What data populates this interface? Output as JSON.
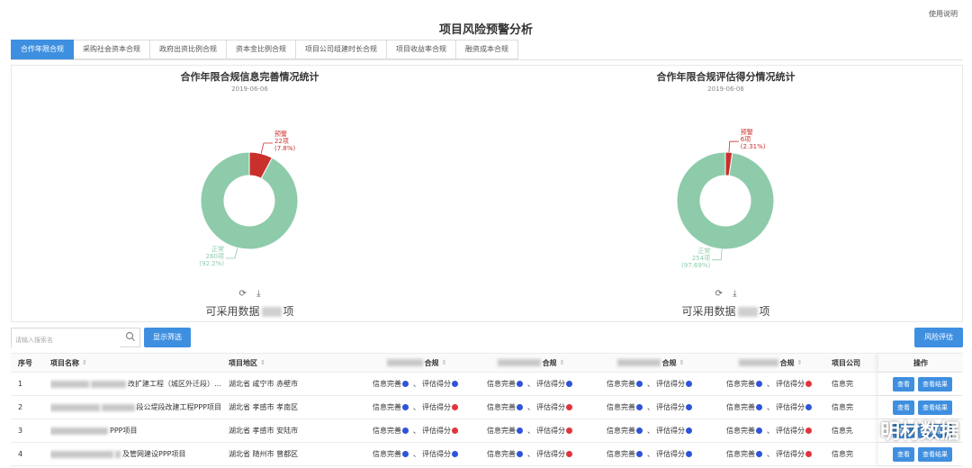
{
  "header": {
    "title": "项目风险预警分析",
    "help_link": "使用说明"
  },
  "tabs": [
    {
      "label": "合作年限合规",
      "active": true
    },
    {
      "label": "采购社会资本合规",
      "active": false
    },
    {
      "label": "政府出资比例合规",
      "active": false
    },
    {
      "label": "资本金比例合规",
      "active": false
    },
    {
      "label": "项目公司组建时长合规",
      "active": false
    },
    {
      "label": "项目收益率合规",
      "active": false
    },
    {
      "label": "融资成本合规",
      "active": false
    }
  ],
  "charts": [
    {
      "title": "合作年限合规信息完善情况统计",
      "date": "2019-06-06",
      "available_prefix": "可采用数据",
      "available_suffix": "项",
      "chart_data": {
        "type": "pie",
        "slices": [
          {
            "name": "预警",
            "count_label": "22项",
            "percent_label": "(7.8%)",
            "value": 7.8,
            "color": "#c9302c"
          },
          {
            "name": "正常",
            "count_label": "260项",
            "percent_label": "(92.2%)",
            "value": 92.2,
            "color": "#8ecbab"
          }
        ]
      }
    },
    {
      "title": "合作年限合规评估得分情况统计",
      "date": "2019-06-06",
      "available_prefix": "可采用数据",
      "available_suffix": "项",
      "chart_data": {
        "type": "pie",
        "slices": [
          {
            "name": "预警",
            "count_label": "6项",
            "percent_label": "(2.31%)",
            "value": 2.31,
            "color": "#c9302c"
          },
          {
            "name": "正常",
            "count_label": "254项",
            "percent_label": "(97.69%)",
            "value": 97.69,
            "color": "#8ecbab"
          }
        ]
      }
    }
  ],
  "toolbar": {
    "search_placeholder": "请输入搜索名",
    "filter_button": "显示筛选",
    "risk_button": "风险评估"
  },
  "table": {
    "columns": {
      "index": "序号",
      "name": "项目名称",
      "area": "项目地区",
      "k1": "合规",
      "k2": "合规",
      "k3": "合规",
      "k4": "合规",
      "k5": "项目公司",
      "op": "操作"
    },
    "status_labels": {
      "info": "信息完善",
      "score": "评估得分"
    },
    "sep": "、",
    "view_button": "查看",
    "result_button": "查看结果",
    "rows": [
      {
        "index": "1",
        "name_suffix": "改扩建工程（城区外迁段）…",
        "area": "湖北省 咸宁市 赤壁市",
        "status": [
          [
            "ok",
            "ok"
          ],
          [
            "ok",
            "ok"
          ],
          [
            "ok",
            "ok"
          ],
          [
            "ok",
            "bad"
          ]
        ],
        "k5": "信息完"
      },
      {
        "index": "2",
        "name_suffix": "段公堤段改建工程PPP项目",
        "area": "湖北省 孝感市 孝南区",
        "status": [
          [
            "ok",
            "bad"
          ],
          [
            "ok",
            "bad"
          ],
          [
            "ok",
            "ok"
          ],
          [
            "ok",
            "ok"
          ]
        ],
        "k5": "信息完"
      },
      {
        "index": "3",
        "name_suffix": "PPP项目",
        "area": "湖北省 孝感市 安陆市",
        "status": [
          [
            "ok",
            "bad"
          ],
          [
            "ok",
            "bad"
          ],
          [
            "ok",
            "ok"
          ],
          [
            "ok",
            "bad"
          ]
        ],
        "k5": "信息完"
      },
      {
        "index": "4",
        "name_suffix": "及管网建设PPP项目",
        "area": "湖北省 随州市 曾都区",
        "status": [
          [
            "ok",
            "ok"
          ],
          [
            "ok",
            "bad"
          ],
          [
            "ok",
            "ok"
          ],
          [
            "ok",
            "bad"
          ]
        ],
        "k5": "信息完"
      }
    ]
  },
  "watermark": {
    "text": "明材数据"
  }
}
